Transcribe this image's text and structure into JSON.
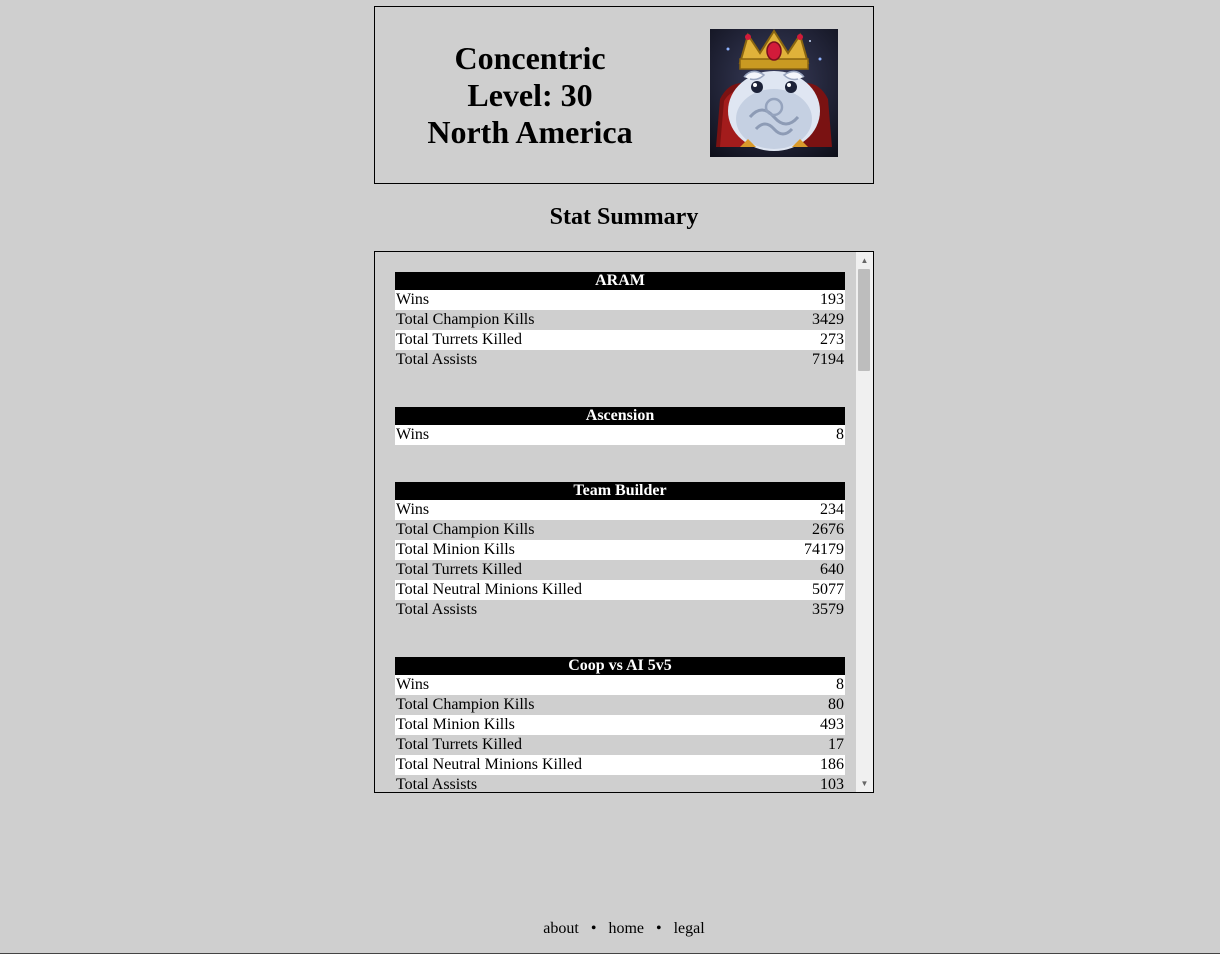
{
  "profile": {
    "summoner_name": "Concentric",
    "level_text": "Level: 30",
    "region": "North America",
    "avatar_icon": "poro-king-icon"
  },
  "stat_summary_title": "Stat Summary",
  "modes": [
    {
      "name": "ARAM",
      "stats": [
        {
          "label": "Wins",
          "value": "193"
        },
        {
          "label": "Total Champion Kills",
          "value": "3429"
        },
        {
          "label": "Total Turrets Killed",
          "value": "273"
        },
        {
          "label": "Total Assists",
          "value": "7194"
        }
      ]
    },
    {
      "name": "Ascension",
      "stats": [
        {
          "label": "Wins",
          "value": "8"
        }
      ]
    },
    {
      "name": "Team Builder",
      "stats": [
        {
          "label": "Wins",
          "value": "234"
        },
        {
          "label": "Total Champion Kills",
          "value": "2676"
        },
        {
          "label": "Total Minion Kills",
          "value": "74179"
        },
        {
          "label": "Total Turrets Killed",
          "value": "640"
        },
        {
          "label": "Total Neutral Minions Killed",
          "value": "5077"
        },
        {
          "label": "Total Assists",
          "value": "3579"
        }
      ]
    },
    {
      "name": "Coop vs AI 5v5",
      "stats": [
        {
          "label": "Wins",
          "value": "8"
        },
        {
          "label": "Total Champion Kills",
          "value": "80"
        },
        {
          "label": "Total Minion Kills",
          "value": "493"
        },
        {
          "label": "Total Turrets Killed",
          "value": "17"
        },
        {
          "label": "Total Neutral Minions Killed",
          "value": "186"
        },
        {
          "label": "Total Assists",
          "value": "103"
        }
      ]
    }
  ],
  "footer": {
    "about": "about",
    "separator": "•",
    "home": "home",
    "legal": "legal"
  },
  "colors": {
    "page_background": "#cfcfcf",
    "header_background": "#000000",
    "row_alt": "#ffffff"
  }
}
